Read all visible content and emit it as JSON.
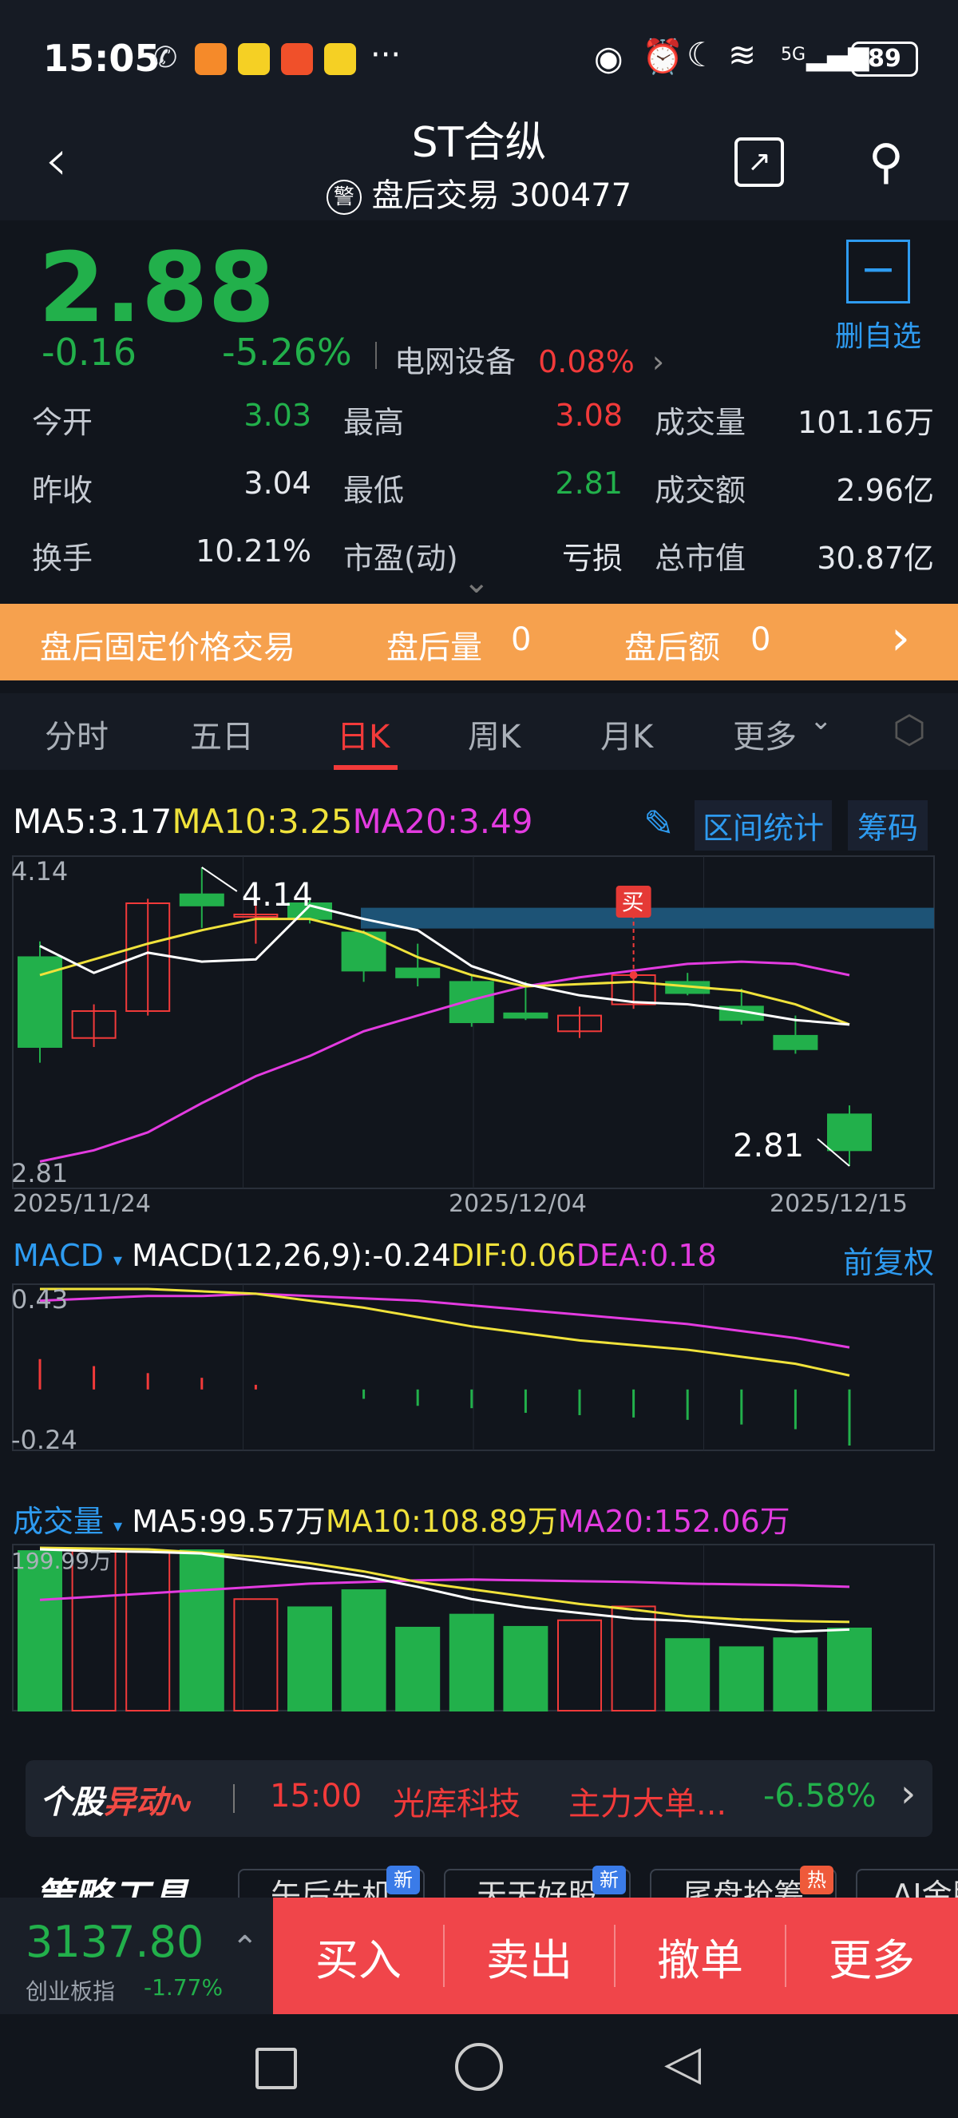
{
  "status": {
    "time": "15:05",
    "battery": "89",
    "network": "5G"
  },
  "header": {
    "title": "ST合纵",
    "warn_badge": "警",
    "subtitle": "盘后交易 300477"
  },
  "quote": {
    "price": "2.88",
    "change": "-0.16",
    "change_pct": "-5.26%",
    "sector": "电网设备",
    "sector_pct": "0.08%",
    "watch_label": "删自选",
    "stats": [
      {
        "label": "今开",
        "value": "3.03",
        "color": "#22b04b"
      },
      {
        "label": "最高",
        "value": "3.08",
        "color": "#f23a3a"
      },
      {
        "label": "成交量",
        "value": "101.16万",
        "color": "#e6e9ee"
      },
      {
        "label": "昨收",
        "value": "3.04",
        "color": "#e6e9ee"
      },
      {
        "label": "最低",
        "value": "2.81",
        "color": "#22b04b"
      },
      {
        "label": "成交额",
        "value": "2.96亿",
        "color": "#e6e9ee"
      },
      {
        "label": "换手",
        "value": "10.21%",
        "color": "#e6e9ee"
      },
      {
        "label": "市盈(动)",
        "value": "亏损",
        "color": "#e6e9ee"
      },
      {
        "label": "总市值",
        "value": "30.87亿",
        "color": "#e6e9ee"
      }
    ]
  },
  "banner": {
    "title": "盘后固定价格交易",
    "vol_label": "盘后量",
    "vol": "0",
    "amt_label": "盘后额",
    "amt": "0"
  },
  "tabs": [
    "分时",
    "五日",
    "日K",
    "周K",
    "月K",
    "更多"
  ],
  "active_tab": 2,
  "kline": {
    "ma5": "MA5:3.17",
    "ma10": "MA10:3.25",
    "ma20": "MA20:3.49",
    "range_stat": "区间统计",
    "chips": "筹码",
    "y_high": "4.14",
    "y_low": "2.81",
    "max_label": "4.14",
    "min_label": "2.81",
    "buy_mark": "买",
    "dates": [
      "2025/11/24",
      "2025/12/04",
      "2025/12/15"
    ]
  },
  "macd": {
    "title": "MACD",
    "params": "MACD(12,26,9):-0.24",
    "dif": "DIF:0.06",
    "dea": "DEA:0.18",
    "adj": "前复权",
    "y_high": "0.43",
    "y_low": "-0.24"
  },
  "volume": {
    "title": "成交量",
    "ma5": "MA5:99.57万",
    "ma10": "MA10:108.89万",
    "ma20": "MA20:152.06万",
    "y_high": "199.99万"
  },
  "chart_data": {
    "type": "candlestick",
    "dates": [
      "2025/11/24",
      "2025/12/04",
      "2025/12/15"
    ],
    "ylim": [
      2.81,
      4.14
    ],
    "candles": [
      {
        "o": 3.74,
        "c": 3.34,
        "h": 3.81,
        "l": 3.27
      },
      {
        "o": 3.38,
        "c": 3.5,
        "h": 3.53,
        "l": 3.34
      },
      {
        "o": 3.5,
        "c": 3.98,
        "h": 4.0,
        "l": 3.48
      },
      {
        "o": 4.02,
        "c": 3.97,
        "h": 4.14,
        "l": 3.87
      },
      {
        "o": 3.93,
        "c": 3.93,
        "h": 4.0,
        "l": 3.8
      },
      {
        "o": 3.98,
        "c": 3.91,
        "h": 4.0,
        "l": 3.89
      },
      {
        "o": 3.85,
        "c": 3.68,
        "h": 3.86,
        "l": 3.63
      },
      {
        "o": 3.69,
        "c": 3.65,
        "h": 3.8,
        "l": 3.61
      },
      {
        "o": 3.63,
        "c": 3.45,
        "h": 3.66,
        "l": 3.43
      },
      {
        "o": 3.49,
        "c": 3.47,
        "h": 3.63,
        "l": 3.46
      },
      {
        "o": 3.41,
        "c": 3.48,
        "h": 3.52,
        "l": 3.38
      },
      {
        "o": 3.53,
        "c": 3.66,
        "h": 3.67,
        "l": 3.51
      },
      {
        "o": 3.63,
        "c": 3.58,
        "h": 3.67,
        "l": 3.57
      },
      {
        "o": 3.52,
        "c": 3.46,
        "h": 3.6,
        "l": 3.44
      },
      {
        "o": 3.39,
        "c": 3.33,
        "h": 3.48,
        "l": 3.31
      },
      {
        "o": 3.04,
        "c": 2.88,
        "h": 3.08,
        "l": 2.81
      }
    ],
    "ma5": [
      3.79,
      3.67,
      3.76,
      3.72,
      3.73,
      3.97,
      3.91,
      3.86,
      3.7,
      3.62,
      3.57,
      3.54,
      3.53,
      3.5,
      3.46,
      3.44
    ],
    "ma10": [
      3.66,
      3.73,
      3.8,
      3.86,
      3.91,
      3.91,
      3.85,
      3.74,
      3.66,
      3.61,
      3.62,
      3.63,
      3.61,
      3.59,
      3.53,
      3.44
    ],
    "ma20": [
      2.83,
      2.88,
      2.96,
      3.09,
      3.21,
      3.3,
      3.41,
      3.48,
      3.55,
      3.61,
      3.65,
      3.68,
      3.71,
      3.72,
      3.71,
      3.66
    ],
    "macd_hist": [
      0.13,
      0.1,
      0.07,
      0.05,
      0.02,
      0.0,
      -0.04,
      -0.07,
      -0.08,
      -0.1,
      -0.11,
      -0.12,
      -0.13,
      -0.15,
      -0.17,
      -0.24
    ],
    "dif": [
      0.43,
      0.43,
      0.43,
      0.42,
      0.41,
      0.38,
      0.35,
      0.31,
      0.27,
      0.24,
      0.21,
      0.19,
      0.17,
      0.14,
      0.11,
      0.06
    ],
    "dea": [
      0.38,
      0.39,
      0.4,
      0.4,
      0.41,
      0.4,
      0.39,
      0.38,
      0.36,
      0.34,
      0.32,
      0.3,
      0.28,
      0.25,
      0.22,
      0.18
    ],
    "volume": [
      196,
      196,
      195,
      197,
      137,
      127,
      148,
      102,
      118,
      103,
      111,
      128,
      88,
      78,
      89,
      101
    ],
    "vol_ma5": [
      198,
      196,
      195,
      193,
      184,
      175,
      165,
      152,
      137,
      127,
      120,
      113,
      110,
      104,
      97,
      99.57
    ],
    "vol_ma10": [
      200,
      199,
      198,
      194,
      189,
      181,
      171,
      158,
      149,
      140,
      131,
      124,
      116,
      112,
      110,
      108.89
    ],
    "vol_ma20": [
      136,
      140,
      144,
      148,
      152,
      156,
      158,
      160,
      161,
      160,
      159,
      158,
      156,
      155,
      154,
      152.06
    ]
  },
  "news": {
    "logo1": "个股",
    "logo2": "异动",
    "time": "15:00",
    "name": "光库科技",
    "desc": "主力大单...",
    "pct": "-6.58%"
  },
  "tools": {
    "title": "策略工具",
    "items": [
      "午后先机",
      "天天好股",
      "尾盘抢筹",
      "AI金股"
    ],
    "badges": [
      "新",
      "新",
      "热"
    ]
  },
  "bottom": {
    "index_value": "3137.80",
    "index_name": "创业板指",
    "index_pct": "-1.77%",
    "actions": [
      "买入",
      "卖出",
      "撤单",
      "更多"
    ]
  }
}
